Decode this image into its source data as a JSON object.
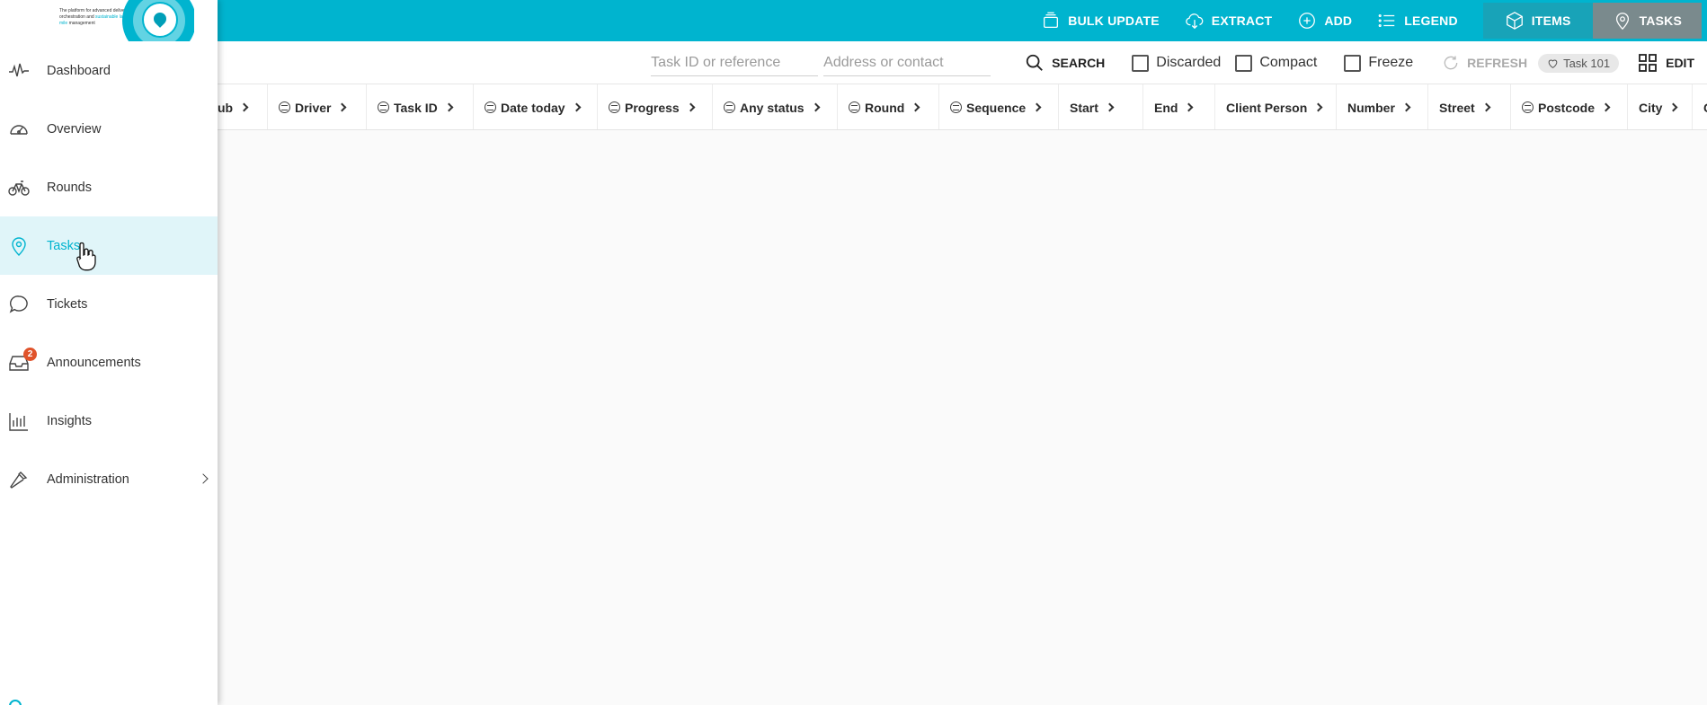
{
  "topbar": {
    "buttons": [
      {
        "label": "BULK UPDATE",
        "icon": "stack-icon"
      },
      {
        "label": "EXTRACT",
        "icon": "cloud-download-icon"
      },
      {
        "label": "ADD",
        "icon": "plus-circle-icon"
      },
      {
        "label": "LEGEND",
        "icon": "list-icon"
      }
    ],
    "items_label": "ITEMS",
    "tasks_label": "TASKS",
    "colors": {
      "bar": "#00b4cf",
      "items_bg": "#18a3b8",
      "tasks_bg": "#7a8a8d"
    }
  },
  "logo": {
    "tagline_1": "The platform for advanced delivery",
    "tagline_2": "orchestration and",
    "tagline_highlight": "sustainable last",
    "tagline_3": "mile",
    "tagline_4": "management"
  },
  "toolbar": {
    "task_id_placeholder": "Task ID or reference",
    "address_placeholder": "Address or contact",
    "search_label": "SEARCH",
    "discarded_label": "Discarded",
    "compact_label": "Compact",
    "freeze_label": "Freeze",
    "refresh_label": "REFRESH",
    "chip_label": "Task 101",
    "edit_label": "EDIT"
  },
  "columns": [
    {
      "label": "ub",
      "filter": false
    },
    {
      "label": "Driver",
      "filter": true
    },
    {
      "label": "Task ID",
      "filter": true
    },
    {
      "label": "Date today",
      "filter": true
    },
    {
      "label": "Progress",
      "filter": true
    },
    {
      "label": "Any status",
      "filter": true
    },
    {
      "label": "Round",
      "filter": true
    },
    {
      "label": "Sequence",
      "filter": true
    },
    {
      "label": "Start",
      "filter": false
    },
    {
      "label": "End",
      "filter": false
    },
    {
      "label": "Client Person",
      "filter": false
    },
    {
      "label": "Number",
      "filter": false
    },
    {
      "label": "Street",
      "filter": false
    },
    {
      "label": "Postcode",
      "filter": true
    },
    {
      "label": "City",
      "filter": false
    },
    {
      "label": "Co",
      "filter": false
    }
  ],
  "sidebar": {
    "items": [
      {
        "label": "Dashboard",
        "icon": "pulse-icon"
      },
      {
        "label": "Overview",
        "icon": "gauge-icon"
      },
      {
        "label": "Rounds",
        "icon": "bicycle-icon"
      },
      {
        "label": "Tasks",
        "icon": "map-pin-icon",
        "active": true
      },
      {
        "label": "Tickets",
        "icon": "chat-bubble-icon"
      },
      {
        "label": "Announcements",
        "icon": "inbox-icon",
        "badge": "2"
      },
      {
        "label": "Insights",
        "icon": "bar-chart-icon"
      },
      {
        "label": "Administration",
        "icon": "hammer-icon",
        "expandable": true
      }
    ]
  }
}
